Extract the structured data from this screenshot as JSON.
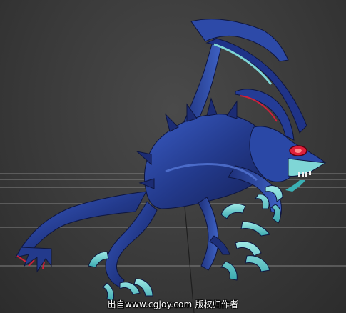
{
  "watermark": {
    "text": "出自www.cgjoy.com 版权归作者"
  },
  "subject": {
    "icon": "creature-render",
    "colors": {
      "body_dark": "#1b2a6b",
      "body_mid": "#2c4aa8",
      "body_light": "#4f74d6",
      "claw": "#5fd0d0",
      "claw_light": "#a9f2ee",
      "eye": "#e0203a",
      "horn": "#2a3f94"
    }
  },
  "viewport": {
    "background": "#3d3d3d",
    "grid_color": "#8a8a8a"
  }
}
